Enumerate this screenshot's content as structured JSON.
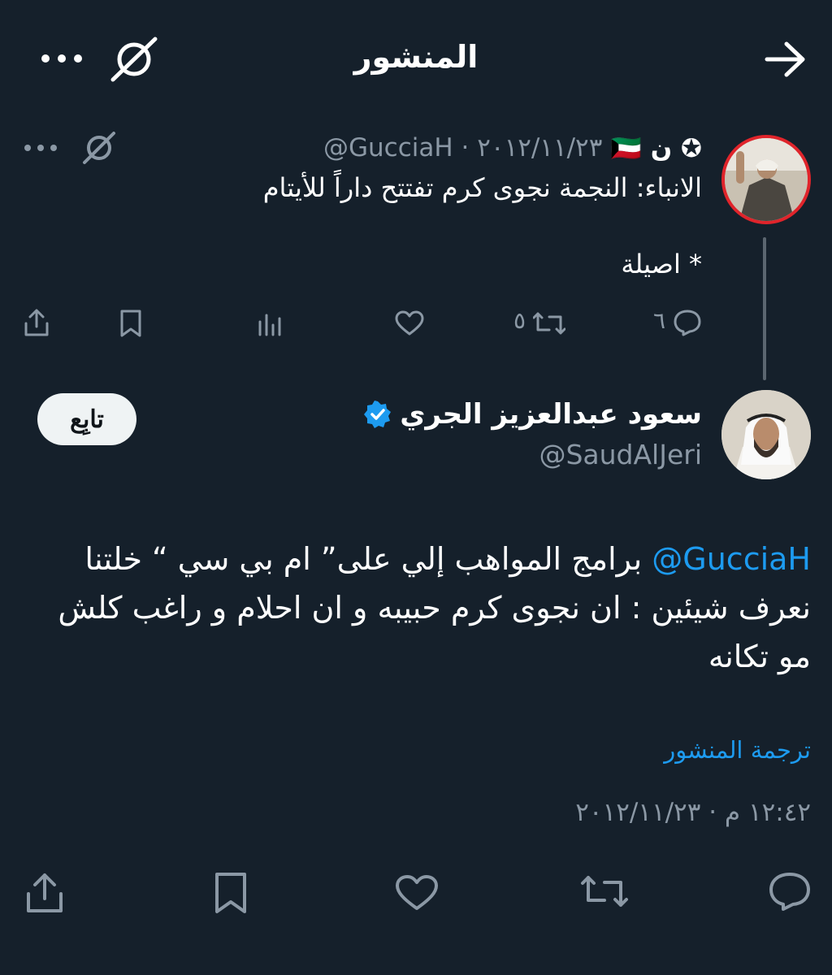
{
  "header": {
    "title": "المنشور",
    "back_icon": "arrow-right-icon",
    "grok_icon": "grok-icon",
    "more_icon": "more-horizontal-icon"
  },
  "parent_tweet": {
    "author_name": "✪ ن 🇰🇼",
    "handle_date": "@GucciaH · ٢٠١٢/١١/٢٣",
    "text_line1": "الانباء: النجمة نجوى كرم تفتتح داراً للأيتام",
    "text_line2": "* اصيلة",
    "replies": "٦",
    "reposts": "٥"
  },
  "main_tweet": {
    "author_name": "سعود عبدالعزيز الجري",
    "handle": "@SaudAlJeri",
    "verified_color": "#1d9bf0",
    "follow_label": "تابِع",
    "mention": "@GucciaH",
    "body_line1": " برامج المواهب إلي على”  ام بي سي “ خلتنا",
    "body_line2": "نعرف شيئين : ان نجوى كرم حبيبه و ان احلام و راغب كلش",
    "body_line3": "مو تكانه",
    "translate_label": "ترجمة المنشور",
    "timestamp": "١٢:٤٢ م · ٢٠١٢/١١/٢٣"
  },
  "colors": {
    "background": "#15202b",
    "secondary_text": "#8b98a5",
    "accent": "#1d9bf0",
    "avatar_ring": "#e0242b"
  }
}
